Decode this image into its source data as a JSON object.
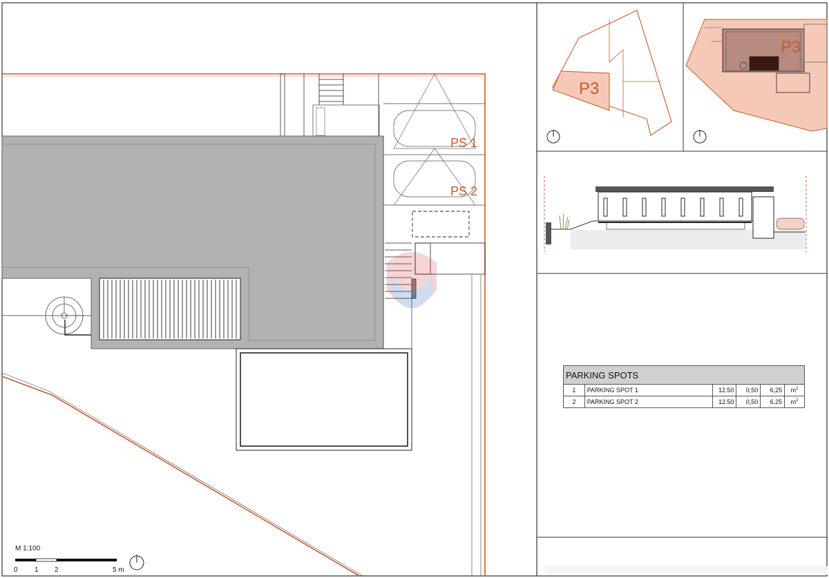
{
  "plan": {
    "labels": {
      "ps1": "PS 1",
      "ps2": "PS 2"
    },
    "scale": {
      "title": "M 1:100",
      "ticks": [
        "0",
        "1",
        "2",
        "5 m"
      ]
    }
  },
  "key_plan_1": {
    "label": "P3"
  },
  "key_plan_2": {
    "label": "P3"
  },
  "parking_table": {
    "title": "PARKING SPOTS",
    "unit": "m",
    "unit_exp": "2",
    "rows": [
      {
        "id": "1",
        "name": "PARKING SPOT 1",
        "v1": "12.50",
        "v2": "0,50",
        "v3": "6,25"
      },
      {
        "id": "2",
        "name": "PARKING SPOT 2",
        "v1": "12.50",
        "v2": "0,50",
        "v3": "6,25"
      }
    ]
  },
  "colors": {
    "plot_line": "#c85a2c",
    "building": "#b2b2b2",
    "highlight": "#f6c8b8",
    "ink": "#222222"
  }
}
